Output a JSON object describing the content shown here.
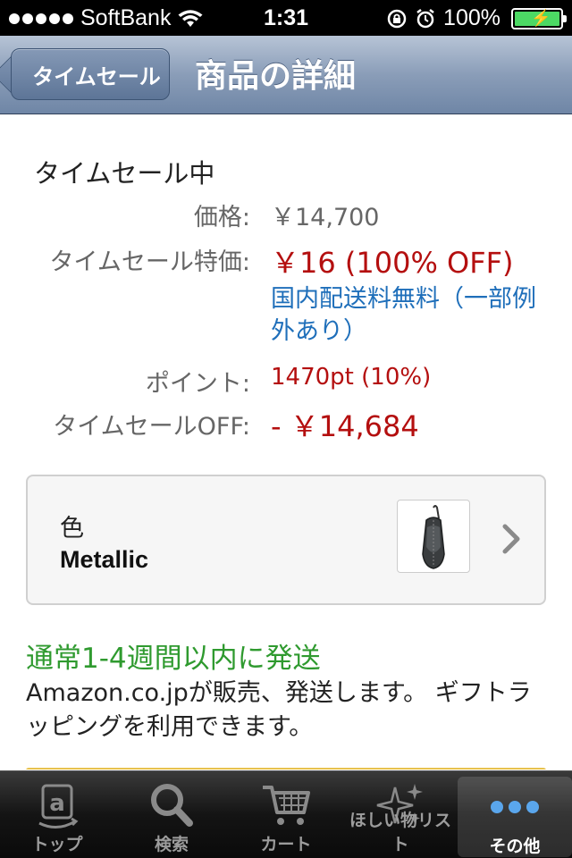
{
  "status_bar": {
    "carrier": "SoftBank",
    "time": "1:31",
    "battery": "100%",
    "battery_level": 1.0
  },
  "nav": {
    "back_label": "タイムセール",
    "title": "商品の詳細"
  },
  "product": {
    "sale_status": "タイムセール中",
    "price_label": "価格:",
    "price_value": "￥14,700",
    "sale_price_label": "タイムセール特価:",
    "sale_price_value": "￥16 (100% OFF)",
    "shipping_note": "国内配送料無料（一部例外あり）",
    "points_label": "ポイント:",
    "points_value": "1470pt (10%)",
    "savings_label": "タイムセールOFF:",
    "savings_value": "- ￥14,684"
  },
  "variation": {
    "label": "色",
    "value": "Metallic"
  },
  "delivery": {
    "availability": "通常1-4週間以内に発送",
    "seller_info": "Amazon.co.jpが販売、発送します。 ギフトラッピングを利用できます。"
  },
  "tabs": [
    {
      "label": "トップ",
      "icon": "amazon-logo-icon",
      "active": false
    },
    {
      "label": "検索",
      "icon": "search-icon",
      "active": false
    },
    {
      "label": "カート",
      "icon": "cart-icon",
      "active": false
    },
    {
      "label": "ほしい物リスト",
      "icon": "sparkle-icon",
      "active": false
    },
    {
      "label": "その他",
      "icon": "more-dots-icon",
      "active": true
    }
  ],
  "colors": {
    "sale_red": "#b40f0f",
    "link_blue": "#1f6fba",
    "availability_green": "#2f9a2f",
    "nav_blue": "#6f86a6"
  }
}
